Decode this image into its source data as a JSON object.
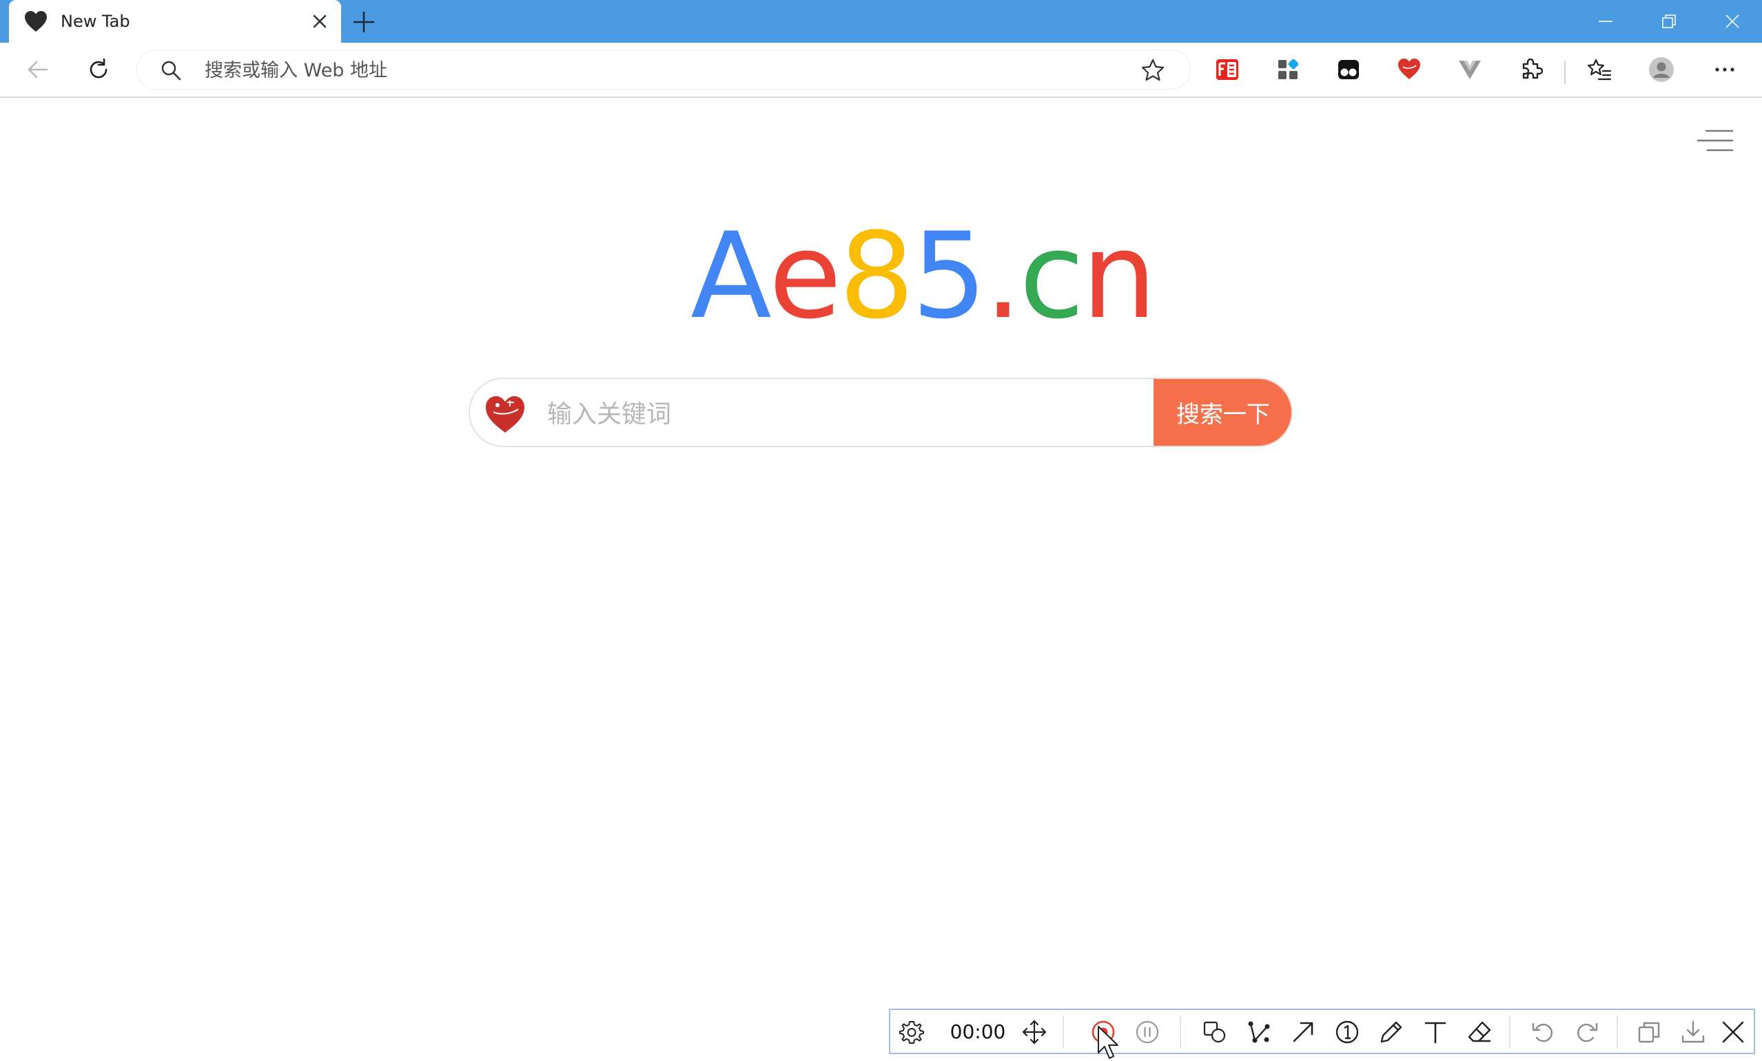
{
  "browser": {
    "tab": {
      "title": "New Tab"
    },
    "address_bar": {
      "placeholder": "搜索或输入 Web 地址",
      "value": ""
    }
  },
  "page": {
    "logo": {
      "letters": [
        "A",
        "e",
        "8",
        "5",
        ".",
        "c",
        "n"
      ],
      "colors": [
        "#4285f4",
        "#ea4335",
        "#fbbc05",
        "#4285f4",
        "#ea4335",
        "#34a853",
        "#ea4335"
      ]
    },
    "search": {
      "placeholder": "输入关键词",
      "button_label": "搜索一下",
      "button_color": "#f6704b"
    }
  },
  "recorder": {
    "timer": "00:00"
  },
  "colors": {
    "titlebar": "#4a9be2",
    "record": "#e2412f"
  }
}
